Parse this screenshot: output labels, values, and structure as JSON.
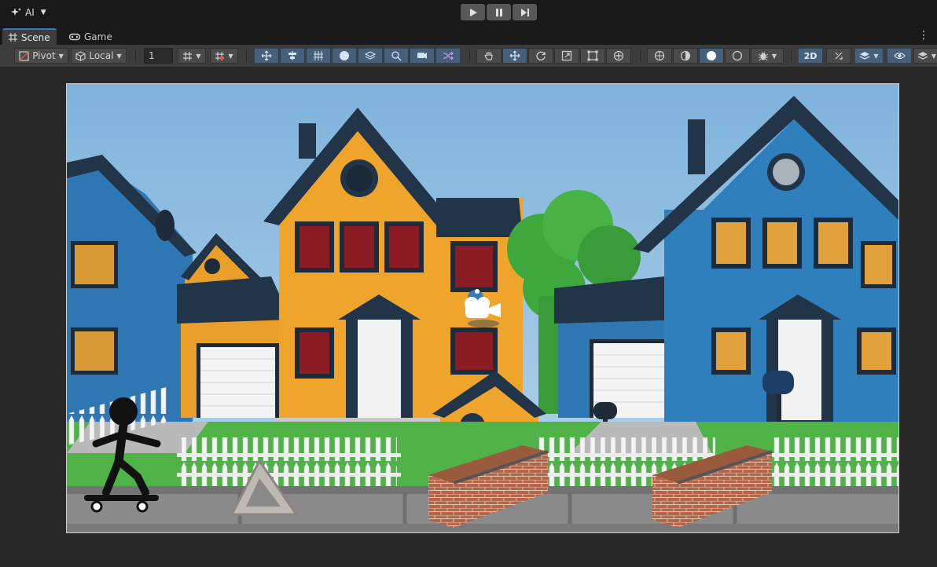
{
  "topbar": {
    "ai_label": "AI",
    "play_icon": "play-icon",
    "pause_icon": "pause-icon",
    "step_icon": "step-icon"
  },
  "tabs": [
    {
      "label": "Scene",
      "icon": "grid-icon",
      "active": true
    },
    {
      "label": "Game",
      "icon": "gamepad-icon",
      "active": false
    }
  ],
  "toolbar": {
    "pivot_label": "Pivot",
    "local_label": "Local",
    "snap_increment": "1",
    "mode_2d_label": "2D"
  },
  "scene": {
    "sky_color": "#8fbde0",
    "road_color": "#8a8a8a",
    "accent_color": "#3a79bb"
  }
}
